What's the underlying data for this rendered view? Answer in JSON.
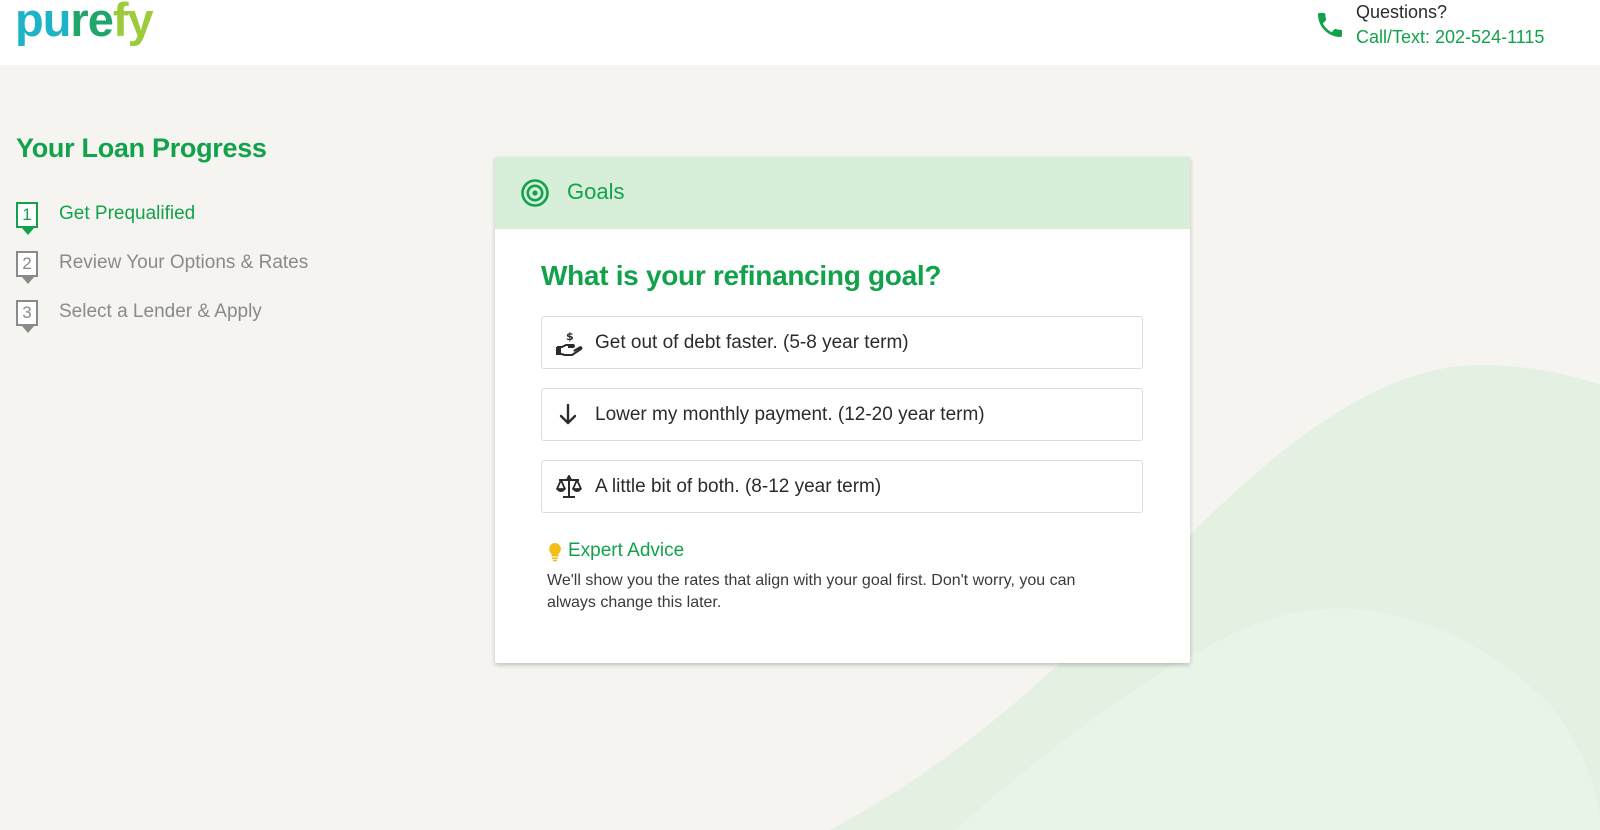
{
  "header": {
    "logo": {
      "part1": "pu",
      "part2": "re",
      "part3": "fy"
    },
    "contact": {
      "icon": "phone-icon",
      "question": "Questions?",
      "phone": "Call/Text: 202-524-1115"
    }
  },
  "progress": {
    "title": "Your Loan Progress",
    "steps": [
      {
        "number": "1",
        "label": "Get Prequalified",
        "active": true
      },
      {
        "number": "2",
        "label": "Review Your Options & Rates",
        "active": false
      },
      {
        "number": "3",
        "label": "Select a Lender & Apply",
        "active": false
      }
    ]
  },
  "card": {
    "header": {
      "icon": "target-icon",
      "title": "Goals"
    },
    "question": "What is your refinancing goal?",
    "options": [
      {
        "icon": "hand-money-icon",
        "label": "Get out of debt faster. (5-8 year term)"
      },
      {
        "icon": "arrow-down-icon",
        "label": "Lower my monthly payment. (12-20 year term)"
      },
      {
        "icon": "scale-icon",
        "label": "A little bit of both. (8-12 year term)"
      }
    ],
    "advice": {
      "icon": "lightbulb-icon",
      "title": "Expert Advice",
      "body": "We'll show you the rates that align with your goal first. Don't worry, you can always change this later."
    }
  },
  "colors": {
    "brand_green": "#12a24b",
    "header_tint": "#d7efd9",
    "page_bg": "#f5f4f0",
    "logo_cyan": "#1fb3c7",
    "logo_lime": "#9ccb3b"
  }
}
